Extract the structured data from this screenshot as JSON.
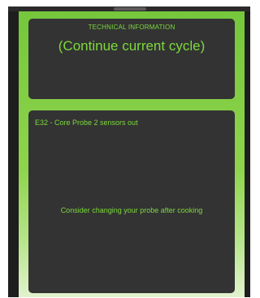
{
  "technical_info": {
    "header": "TECHNICAL INFORMATION",
    "title": "(Continue current cycle)"
  },
  "error": {
    "code_message": "E32 - Core Probe 2 sensors out",
    "advice": "Consider changing your probe after cooking"
  },
  "colors": {
    "accent_green": "#7cd93c",
    "card_background": "#333333",
    "panel_gradient_top": "#75c73c",
    "panel_gradient_bottom": "#e1f2cd"
  }
}
